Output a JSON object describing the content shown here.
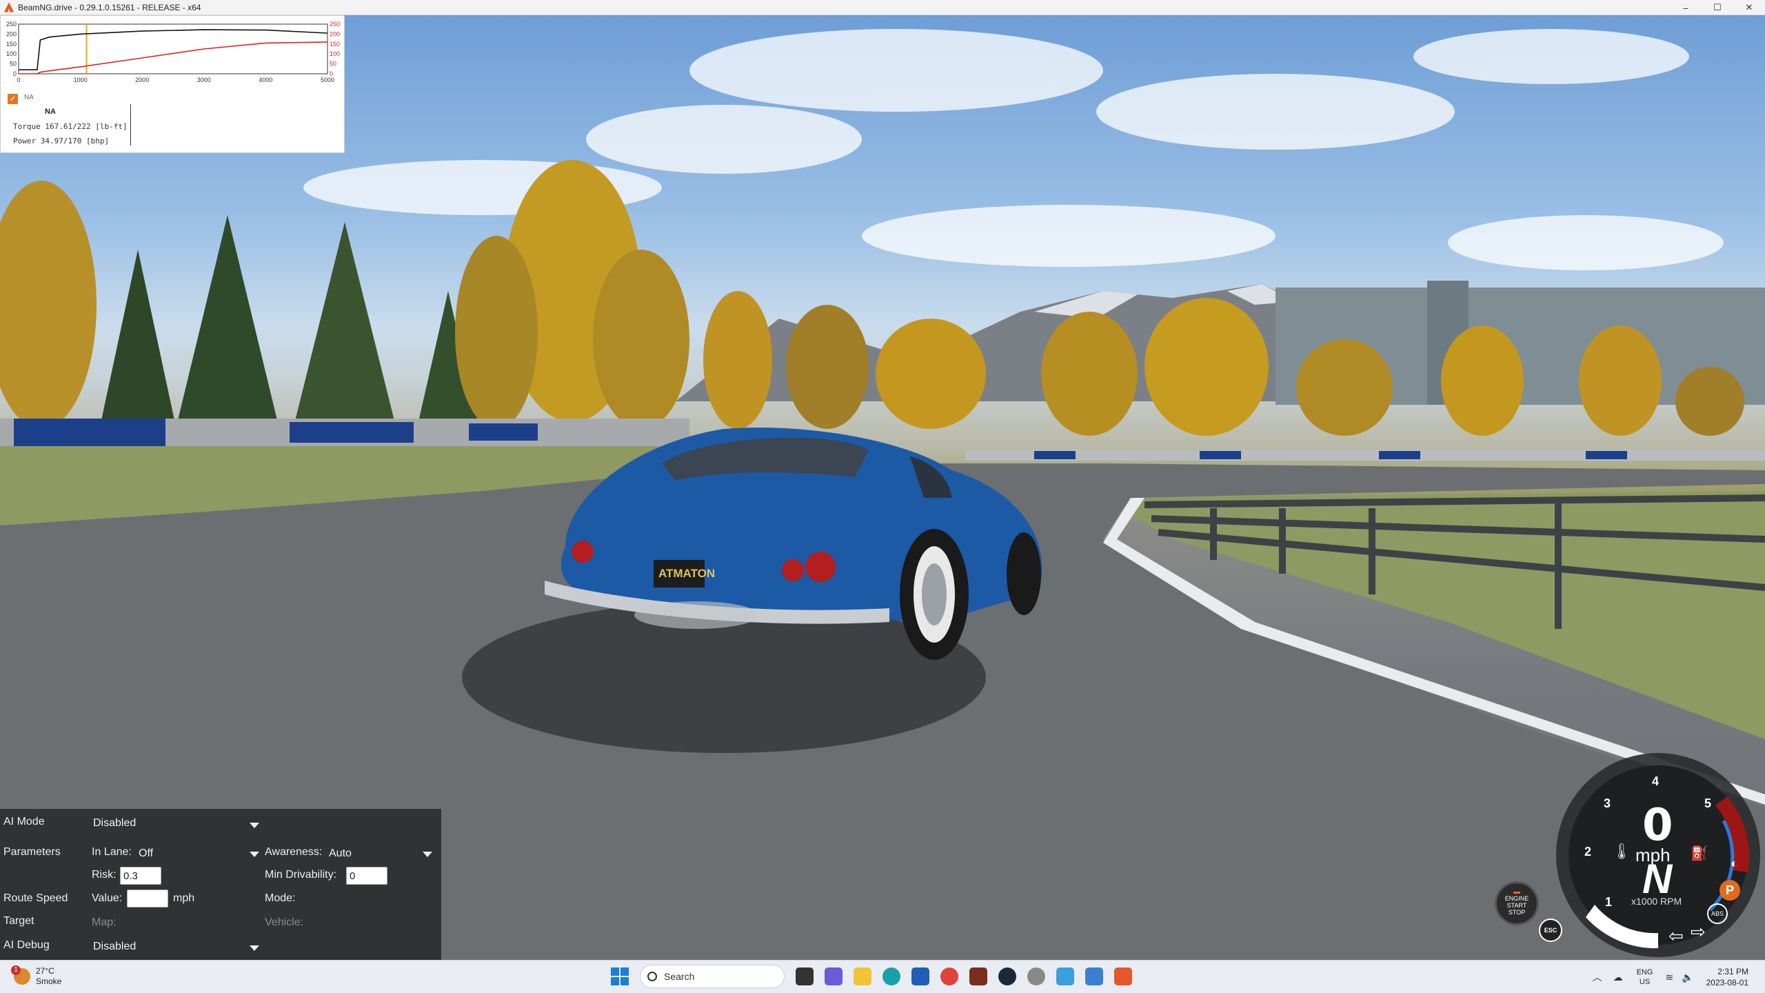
{
  "window": {
    "title": "BeamNG.drive - 0.29.1.0.15261 - RELEASE - x64",
    "minimize": "–",
    "maximize": "☐",
    "close": "✕"
  },
  "torque_graph": {
    "series_label": "NA",
    "engine_title": "NA",
    "torque_readout": "Torque 167.61/222 [lb-ft]",
    "power_readout": "Power  34.97/170  [bhp]",
    "chart_data": {
      "type": "line",
      "x": [
        0,
        300,
        350,
        500,
        1000,
        2000,
        3000,
        4000,
        5000
      ],
      "xticks": [
        "0",
        "1000",
        "2000",
        "3000",
        "4000",
        "5000"
      ],
      "yticks_left": [
        "250",
        "200",
        "150",
        "100",
        "50",
        "0"
      ],
      "yticks_right": [
        "250",
        "200",
        "150",
        "100",
        "50",
        "0"
      ],
      "xlim": [
        0,
        5000
      ],
      "ylim": [
        0,
        250
      ],
      "series": [
        {
          "values": [
            20,
            20,
            170,
            185,
            200,
            215,
            222,
            220,
            205
          ]
        },
        {
          "values": [
            0,
            0,
            8,
            15,
            35,
            80,
            125,
            155,
            160
          ]
        }
      ],
      "marker_x": 1100,
      "colors": {
        "torque": "#111111",
        "power": "#e02020",
        "marker": "#f0a020"
      }
    }
  },
  "ai_panel": {
    "ai_mode_label": "AI Mode",
    "ai_mode_value": "Disabled",
    "parameters_label": "Parameters",
    "in_lane_label": "In Lane:",
    "in_lane_value": "Off",
    "awareness_label": "Awareness:",
    "awareness_value": "Auto",
    "risk_label": "Risk:",
    "risk_value": "0.3",
    "min_drivability_label": "Min Drivability:",
    "min_drivability_value": "0",
    "route_speed_label": "Route Speed",
    "value_label": "Value:",
    "value_input": "",
    "mph_label": "mph",
    "mode_label": "Mode:",
    "target_label": "Target",
    "map_label": "Map:",
    "vehicle_label": "Vehicle:",
    "ai_debug_label": "AI Debug",
    "ai_debug_value": "Disabled"
  },
  "dashboard": {
    "speed": "0",
    "speed_unit": "mph",
    "gear": "N",
    "rpm_unit": "x1000 RPM",
    "ticks": [
      "1",
      "2",
      "3",
      "4",
      "5"
    ],
    "engine_button": [
      "ENGINE",
      "START",
      "STOP"
    ],
    "esc_label": "ESC",
    "abs_label": "ABS",
    "park_label": "P",
    "redline_color": "#9c1616"
  },
  "taskbar": {
    "weather_badge": "1",
    "temperature": "27°C",
    "weather_text": "Smoke",
    "search_placeholder": "Search",
    "lang_top": "ENG",
    "lang_bottom": "US",
    "time": "2:31 PM",
    "date": "2023-08-01"
  }
}
